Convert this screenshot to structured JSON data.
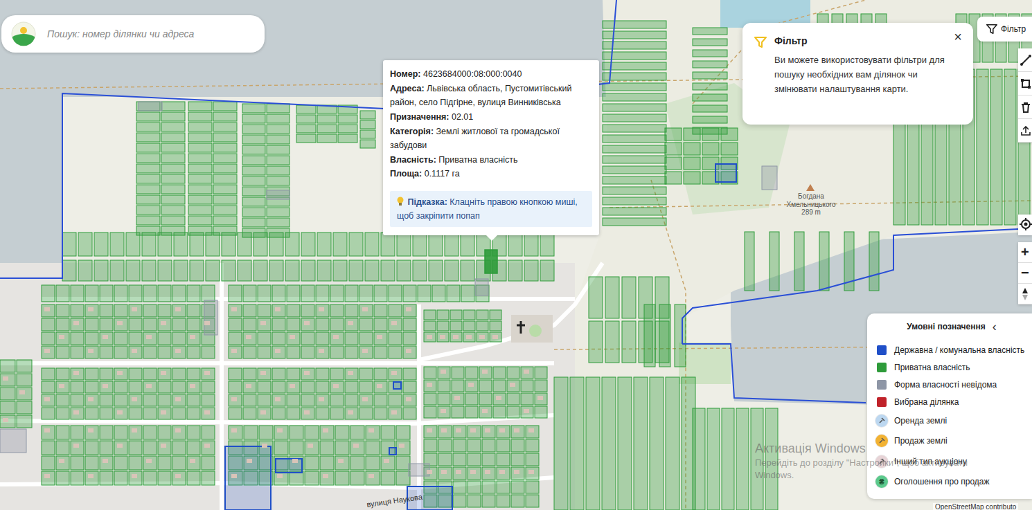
{
  "search": {
    "placeholder": "Пошук: номер ділянки чи адреса"
  },
  "filter_button": {
    "label": "Фільтр"
  },
  "filter_tip": {
    "title": "Фільтр",
    "text": "Ви можете використовувати фільтри для пошуку необхідних вам ділянок чи змінювати налаштування карти.",
    "close": "×"
  },
  "parcel_popup": {
    "highlighted": true,
    "fields": [
      {
        "label": "Номер:",
        "value": "4623684000:08:000:0040"
      },
      {
        "label": "Адреса:",
        "value": "Львівська область, Пустомитівський район, село Підгірне, вулиця Винниківська"
      },
      {
        "label": "Призначення:",
        "value": "02.01"
      },
      {
        "label": "Категорія:",
        "value": "Землі житлової та громадської забудови"
      },
      {
        "label": "Власність:",
        "value": "Приватна власність"
      },
      {
        "label": "Площа:",
        "value": "0.1117 га"
      }
    ],
    "hint_label": "Підказка:",
    "hint_text": "Клацніть правою кнопкою миші, щоб закріпити попап"
  },
  "zoom": {
    "in": "+",
    "out": "−"
  },
  "legend": {
    "title": "Умовні позначення",
    "toggle": "‹",
    "items": [
      {
        "label": "Державна / комунальна власність",
        "kind": "swatch",
        "color": "#1f4fc8",
        "icon": ""
      },
      {
        "label": "Приватна власність",
        "kind": "swatch",
        "color": "#2e9b3a",
        "icon": ""
      },
      {
        "label": "Форма власності невідома",
        "kind": "swatch",
        "color": "#8e96a6",
        "icon": ""
      },
      {
        "label": "Вибрана ділянка",
        "kind": "swatch",
        "color": "#c0222a",
        "icon": ""
      },
      {
        "label": "Оренда землі",
        "kind": "marker",
        "color": "#bcd7f0",
        "icon": ""
      },
      {
        "label": "Продаж землі",
        "kind": "marker",
        "color": "#f2b233",
        "icon": ""
      },
      {
        "label": "Інший тип аукціону",
        "kind": "marker",
        "color": "#e7d3d6",
        "icon": ""
      },
      {
        "label": "Оголошення про продаж",
        "kind": "marker",
        "color": "#5cc98c",
        "icon": "₴"
      }
    ]
  },
  "map_labels": {
    "peak_name": "Богдана Хмельницького",
    "peak_elevation": "289 m",
    "street": "вулиця Наукова"
  },
  "watermark": {
    "title": "Активація Windows",
    "lines": [
      "Перейдіть до розділу \"Настройки\", щоб активувати",
      "Windows."
    ]
  },
  "attribution": "OpenStreetMap contributo"
}
